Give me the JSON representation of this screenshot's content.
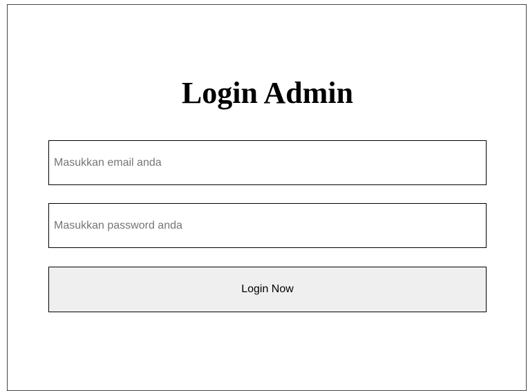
{
  "login": {
    "title": "Login Admin",
    "email": {
      "placeholder": "Masukkan email anda",
      "value": ""
    },
    "password": {
      "placeholder": "Masukkan password anda",
      "value": ""
    },
    "submit_label": "Login Now"
  },
  "colors": {
    "background": "#ffffff",
    "border": "#000000",
    "button_background": "#efefef",
    "placeholder_text": "#757575"
  }
}
